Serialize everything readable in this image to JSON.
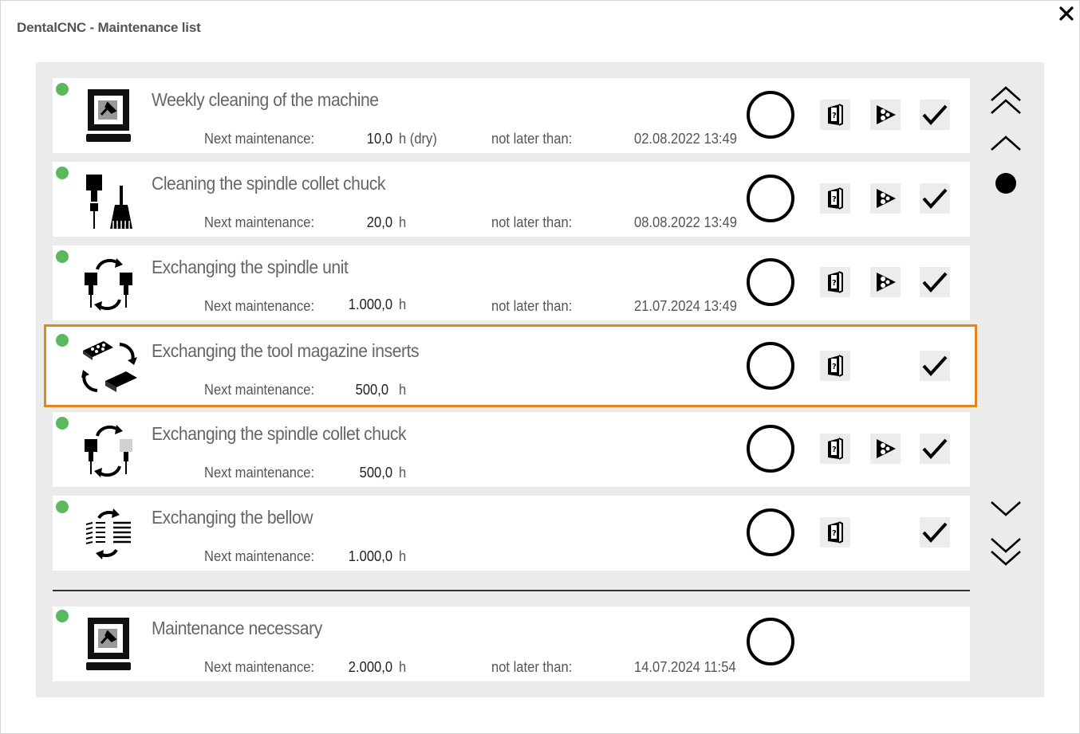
{
  "window": {
    "title": "DentalCNC - Maintenance list"
  },
  "labels": {
    "next_maintenance": "Next maintenance:",
    "not_later_than": "not later than:"
  },
  "items": [
    {
      "name": "Weekly cleaning of the machine",
      "value": "10,0",
      "unit": "h (dry)",
      "date": "02.08.2022 13:49",
      "icon": "machine-cleaning-icon",
      "actions": [
        "manual",
        "video",
        "confirm"
      ]
    },
    {
      "name": "Cleaning the spindle collet chuck",
      "value": "20,0",
      "unit": "h",
      "date": "08.08.2022 13:49",
      "icon": "spindle-brush-icon",
      "actions": [
        "manual",
        "video",
        "confirm"
      ]
    },
    {
      "name": "Exchanging the spindle unit",
      "value": "1.000,0",
      "unit": "h",
      "date": "21.07.2024 13:49",
      "icon": "spindle-exchange-icon",
      "actions": [
        "manual",
        "video",
        "confirm"
      ]
    },
    {
      "name": "Exchanging the tool magazine inserts",
      "value": "500,0",
      "unit": "h",
      "date": "",
      "icon": "magazine-inserts-icon",
      "actions": [
        "manual",
        "confirm"
      ]
    },
    {
      "name": "Exchanging the spindle collet chuck",
      "value": "500,0",
      "unit": "h",
      "date": "",
      "icon": "collet-exchange-icon",
      "actions": [
        "manual",
        "video",
        "confirm"
      ]
    },
    {
      "name": "Exchanging the bellow",
      "value": "1.000,0",
      "unit": "h",
      "date": "",
      "icon": "bellow-exchange-icon",
      "actions": [
        "manual",
        "confirm"
      ]
    }
  ],
  "summary": {
    "name": "Maintenance necessary",
    "value": "2.000,0",
    "unit": "h",
    "date": "14.07.2024 11:54",
    "icon": "machine-cleaning-icon"
  },
  "status_color": "#5cb85c",
  "highlight_color": "#e0861d"
}
